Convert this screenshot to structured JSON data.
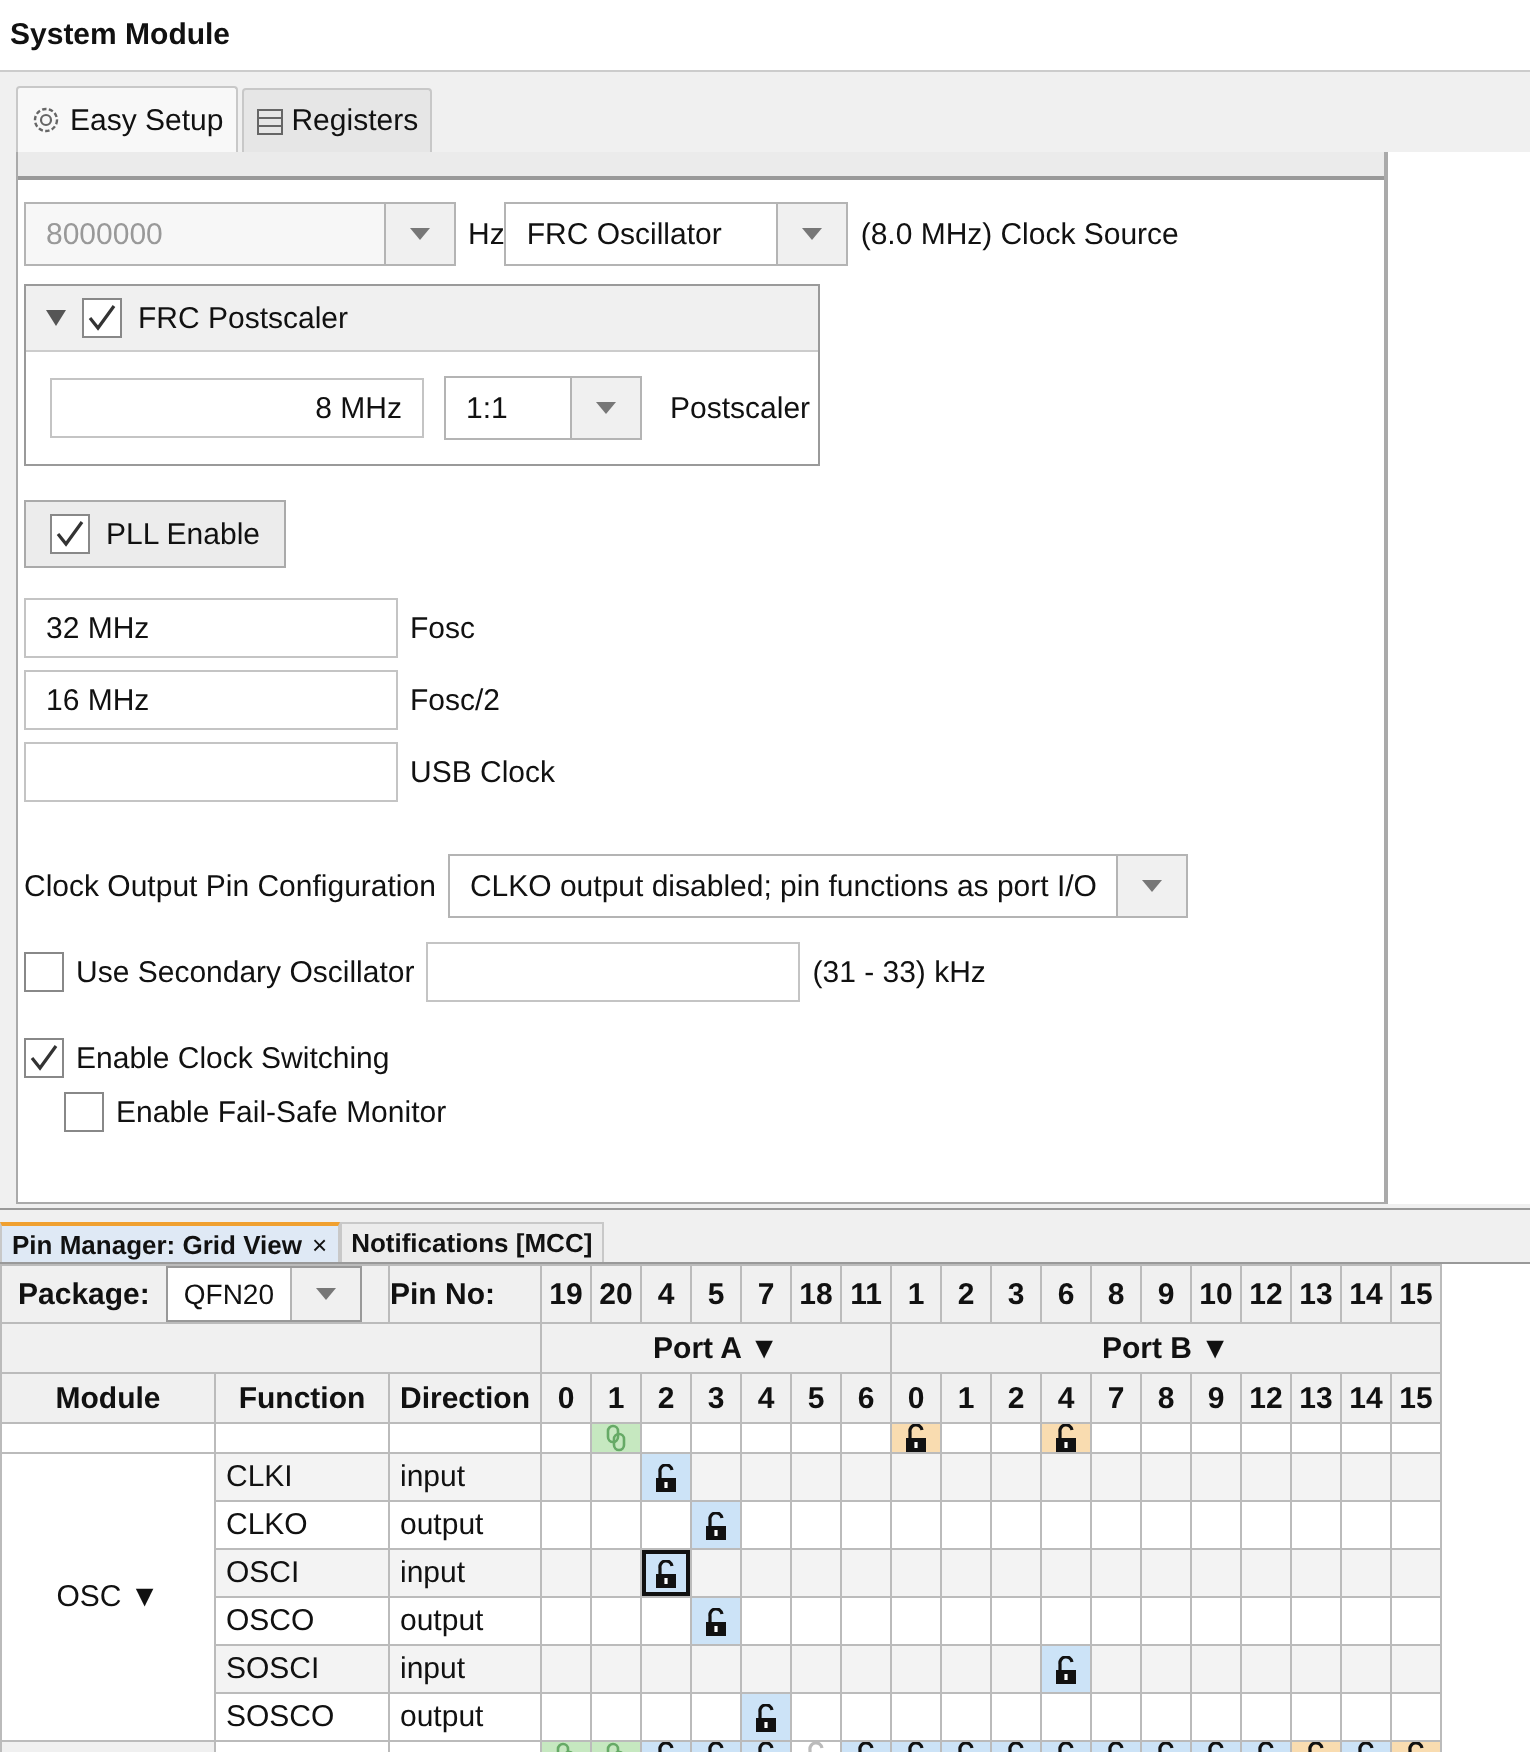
{
  "window": {
    "title": "System Module"
  },
  "tabs": [
    {
      "label": "Easy Setup",
      "selected": true
    },
    {
      "label": "Registers",
      "selected": false
    }
  ],
  "oscillator": {
    "frequency": {
      "value": "8000000",
      "disabled": true
    },
    "frequency_unit": "Hz",
    "clock_source": {
      "value": "FRC Oscillator"
    },
    "clock_note": "(8.0 MHz)",
    "clock_source_label": "Clock Source"
  },
  "frc_postscaler": {
    "label": "FRC Postscaler",
    "expanded": true,
    "checked": true,
    "frequency": "8 MHz",
    "ratio": "1:1",
    "ratio_label": "Postscaler"
  },
  "pll_enable": {
    "label": "PLL Enable",
    "checked": true
  },
  "frequencies": [
    {
      "value": "32 MHz",
      "label": "Fosc"
    },
    {
      "value": "16 MHz",
      "label": "Fosc/2"
    },
    {
      "label": "USB Clock"
    }
  ],
  "clock_output": {
    "label": "Clock Output Pin Configuration",
    "value": "CLKO output disabled; pin functions as port I/O"
  },
  "secondary_oscillator": {
    "label": "Use Secondary Oscillator",
    "checked": false,
    "range": "(31 - 33) kHz"
  },
  "clock_switching": {
    "label": "Enable Clock Switching",
    "checked": true
  },
  "fail_safe": {
    "label": "Enable Fail-Safe Monitor",
    "checked": false
  },
  "bottom_tabs": [
    {
      "label": "Pin Manager: Grid View",
      "selected": true,
      "close_icon": "×"
    },
    {
      "label": "Notifications [MCC]",
      "selected": false
    }
  ],
  "pin_grid": {
    "package_label": "Package:",
    "package": "QFN20",
    "pin_no_label": "Pin No:",
    "pins": [
      "19",
      "20",
      "4",
      "5",
      "7",
      "18",
      "11",
      "1",
      "2",
      "3",
      "6",
      "8",
      "9",
      "10",
      "12",
      "13",
      "14",
      "15"
    ],
    "ports": [
      {
        "label": "Port A ▼",
        "bits": [
          "0",
          "1",
          "2",
          "3",
          "4",
          "5",
          "6"
        ]
      },
      {
        "label": "Port B ▼",
        "bits": [
          "0",
          "1",
          "2",
          "4",
          "7",
          "8",
          "9",
          "12",
          "13",
          "14",
          "15"
        ]
      }
    ],
    "headers": [
      "Module",
      "Function",
      "Direction"
    ],
    "top_partial_cells": [
      {
        "kind": "empty"
      },
      {
        "kind": "chain",
        "color": "#c6e8c0"
      },
      {
        "kind": "empty"
      },
      {
        "kind": "empty"
      },
      {
        "kind": "empty"
      },
      {
        "kind": "empty"
      },
      {
        "kind": "empty"
      },
      {
        "kind": "lock",
        "color": "#f9dcb0"
      },
      {
        "kind": "empty"
      },
      {
        "kind": "empty"
      },
      {
        "kind": "lock",
        "color": "#f9dcb0"
      },
      {
        "kind": "empty"
      },
      {
        "kind": "empty"
      },
      {
        "kind": "empty"
      },
      {
        "kind": "empty"
      },
      {
        "kind": "empty"
      },
      {
        "kind": "empty"
      },
      {
        "kind": "empty"
      }
    ],
    "module": "OSC ▼",
    "rows": [
      {
        "function": "CLKI",
        "direction": "input",
        "cells": [
          {
            "kind": "empty"
          },
          {
            "kind": "empty"
          },
          {
            "kind": "lock",
            "color": "#cce3f7"
          },
          {
            "kind": "empty"
          },
          {
            "kind": "empty"
          },
          {
            "kind": "empty"
          },
          {
            "kind": "empty"
          },
          {
            "kind": "empty"
          },
          {
            "kind": "empty"
          },
          {
            "kind": "empty"
          },
          {
            "kind": "empty"
          },
          {
            "kind": "empty"
          },
          {
            "kind": "empty"
          },
          {
            "kind": "empty"
          },
          {
            "kind": "empty"
          },
          {
            "kind": "empty"
          },
          {
            "kind": "empty"
          },
          {
            "kind": "empty"
          }
        ]
      },
      {
        "function": "CLKO",
        "direction": "output",
        "cells": [
          {
            "kind": "empty"
          },
          {
            "kind": "empty"
          },
          {
            "kind": "empty"
          },
          {
            "kind": "lock",
            "color": "#cce3f7"
          },
          {
            "kind": "empty"
          },
          {
            "kind": "empty"
          },
          {
            "kind": "empty"
          },
          {
            "kind": "empty"
          },
          {
            "kind": "empty"
          },
          {
            "kind": "empty"
          },
          {
            "kind": "empty"
          },
          {
            "kind": "empty"
          },
          {
            "kind": "empty"
          },
          {
            "kind": "empty"
          },
          {
            "kind": "empty"
          },
          {
            "kind": "empty"
          },
          {
            "kind": "empty"
          },
          {
            "kind": "empty"
          }
        ]
      },
      {
        "function": "OSCI",
        "direction": "input",
        "cells": [
          {
            "kind": "empty"
          },
          {
            "kind": "empty"
          },
          {
            "kind": "focuslock",
            "color": "#cce3f7"
          },
          {
            "kind": "empty"
          },
          {
            "kind": "empty"
          },
          {
            "kind": "empty"
          },
          {
            "kind": "empty"
          },
          {
            "kind": "empty"
          },
          {
            "kind": "empty"
          },
          {
            "kind": "empty"
          },
          {
            "kind": "empty"
          },
          {
            "kind": "empty"
          },
          {
            "kind": "empty"
          },
          {
            "kind": "empty"
          },
          {
            "kind": "empty"
          },
          {
            "kind": "empty"
          },
          {
            "kind": "empty"
          },
          {
            "kind": "empty"
          }
        ]
      },
      {
        "function": "OSCO",
        "direction": "output",
        "cells": [
          {
            "kind": "empty"
          },
          {
            "kind": "empty"
          },
          {
            "kind": "empty"
          },
          {
            "kind": "lock",
            "color": "#cce3f7"
          },
          {
            "kind": "empty"
          },
          {
            "kind": "empty"
          },
          {
            "kind": "empty"
          },
          {
            "kind": "empty"
          },
          {
            "kind": "empty"
          },
          {
            "kind": "empty"
          },
          {
            "kind": "empty"
          },
          {
            "kind": "empty"
          },
          {
            "kind": "empty"
          },
          {
            "kind": "empty"
          },
          {
            "kind": "empty"
          },
          {
            "kind": "empty"
          },
          {
            "kind": "empty"
          },
          {
            "kind": "empty"
          }
        ]
      },
      {
        "function": "SOSCI",
        "direction": "input",
        "cells": [
          {
            "kind": "empty"
          },
          {
            "kind": "empty"
          },
          {
            "kind": "empty"
          },
          {
            "kind": "empty"
          },
          {
            "kind": "empty"
          },
          {
            "kind": "empty"
          },
          {
            "kind": "empty"
          },
          {
            "kind": "empty"
          },
          {
            "kind": "empty"
          },
          {
            "kind": "empty"
          },
          {
            "kind": "lock",
            "color": "#cce3f7"
          },
          {
            "kind": "empty"
          },
          {
            "kind": "empty"
          },
          {
            "kind": "empty"
          },
          {
            "kind": "empty"
          },
          {
            "kind": "empty"
          },
          {
            "kind": "empty"
          },
          {
            "kind": "empty"
          }
        ]
      },
      {
        "function": "SOSCO",
        "direction": "output",
        "cells": [
          {
            "kind": "empty"
          },
          {
            "kind": "empty"
          },
          {
            "kind": "empty"
          },
          {
            "kind": "empty"
          },
          {
            "kind": "lock",
            "color": "#cce3f7"
          },
          {
            "kind": "empty"
          },
          {
            "kind": "empty"
          },
          {
            "kind": "empty"
          },
          {
            "kind": "empty"
          },
          {
            "kind": "empty"
          },
          {
            "kind": "empty"
          },
          {
            "kind": "empty"
          },
          {
            "kind": "empty"
          },
          {
            "kind": "empty"
          },
          {
            "kind": "empty"
          },
          {
            "kind": "empty"
          },
          {
            "kind": "empty"
          },
          {
            "kind": "empty"
          }
        ]
      }
    ],
    "bottom_partial_cells": [
      {
        "kind": "chain",
        "color": "#c6e8c0"
      },
      {
        "kind": "chain",
        "color": "#c6e8c0"
      },
      {
        "kind": "lock",
        "color": "#cce3f7"
      },
      {
        "kind": "lock",
        "color": "#cce3f7"
      },
      {
        "kind": "lock",
        "color": "#cce3f7"
      },
      {
        "kind": "faded"
      },
      {
        "kind": "lock",
        "color": "#cce3f7"
      },
      {
        "kind": "lock",
        "color": "#cce3f7"
      },
      {
        "kind": "lock",
        "color": "#cce3f7"
      },
      {
        "kind": "lock",
        "color": "#cce3f7"
      },
      {
        "kind": "lock",
        "color": "#cce3f7"
      },
      {
        "kind": "lock",
        "color": "#cce3f7"
      },
      {
        "kind": "lock",
        "color": "#cce3f7"
      },
      {
        "kind": "lock",
        "color": "#cce3f7"
      },
      {
        "kind": "lock",
        "color": "#cce3f7"
      },
      {
        "kind": "lock",
        "color": "#f9dcb0"
      },
      {
        "kind": "lock",
        "color": "#cce3f7"
      },
      {
        "kind": "lock",
        "color": "#f9dcb0"
      }
    ]
  }
}
